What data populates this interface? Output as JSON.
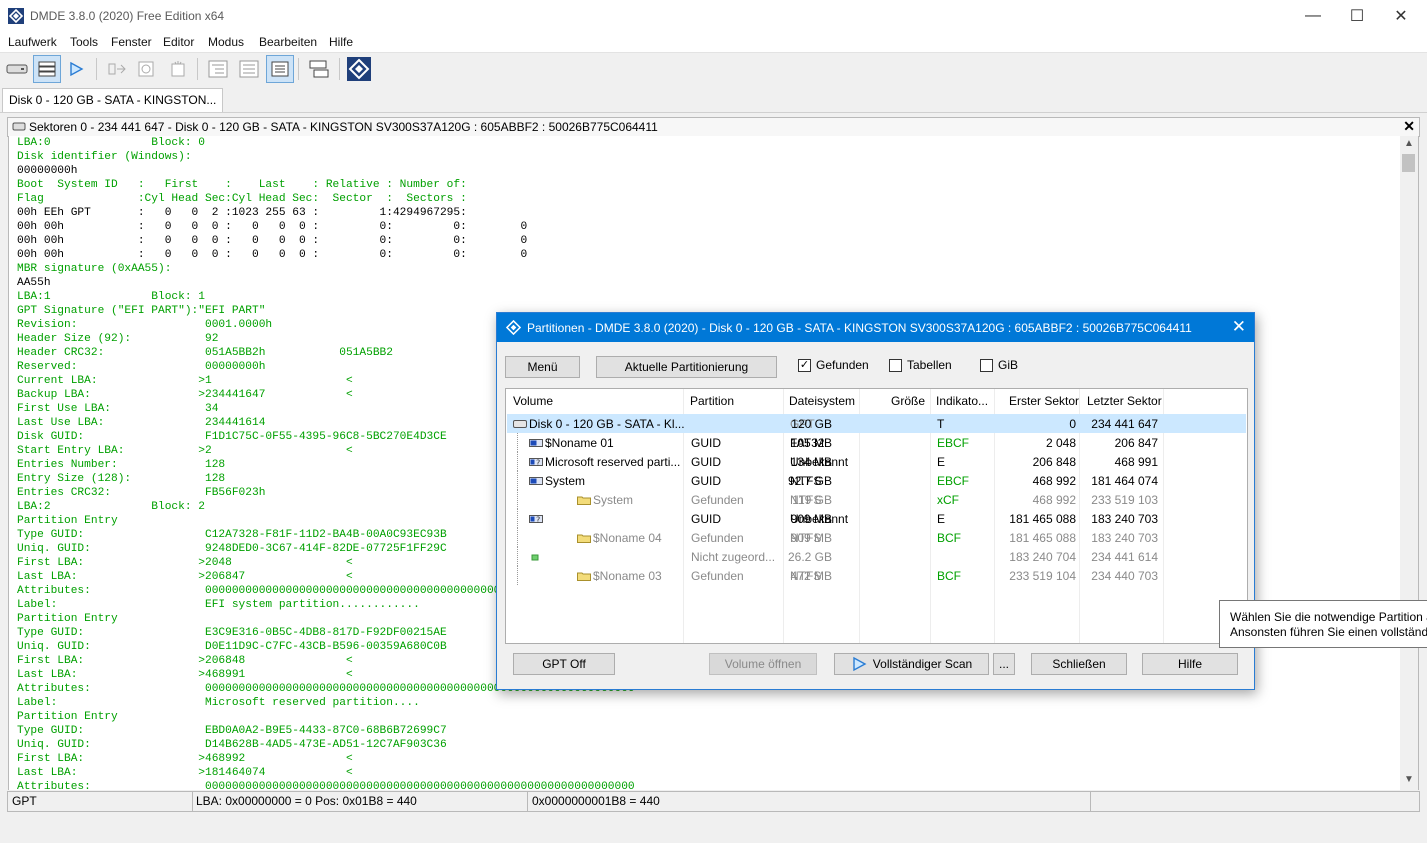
{
  "window": {
    "title": "DMDE 3.8.0 (2020) Free Edition x64"
  },
  "menu": [
    "Laufwerk",
    "Tools",
    "Fenster",
    "Editor",
    "Modus",
    "Bearbeiten",
    "Hilfe"
  ],
  "tab": {
    "label": "Disk 0 - 120 GB - SATA - KINGSTON..."
  },
  "sector_panel": {
    "title": "Sektoren 0 - 234 441 647 - Disk 0 - 120 GB - SATA - KINGSTON SV300S37A120G : 605ABBF2 : 50026B775C064411"
  },
  "hex_lines": [
    "LBA:0               Block: 0",
    "Disk identifier (Windows):",
    "00000000h",
    "Boot  System ID   :   First    :    Last    : Relative : Number of:",
    "Flag              :Cyl Head Sec:Cyl Head Sec:  Sector  :  Sectors :",
    "00h EEh GPT       :   0   0  2 :1023 255 63 :         1:4294967295:",
    "00h 00h           :   0   0  0 :   0   0  0 :         0:         0:        0",
    "00h 00h           :   0   0  0 :   0   0  0 :         0:         0:        0",
    "00h 00h           :   0   0  0 :   0   0  0 :         0:         0:        0",
    "MBR signature (0xAA55):",
    "AA55h",
    "LBA:1               Block: 1",
    "GPT Signature (\"EFI PART\"):\"EFI PART\"",
    "Revision:                   0001.0000h",
    "Header Size (92):           92",
    "Header CRC32:               051A5BB2h           051A5BB2",
    "Reserved:                   00000000h",
    "Current LBA:               >1                    <",
    "Backup LBA:                >234441647            <",
    "First Use LBA:              34",
    "Last Use LBA:               234441614",
    "Disk GUID:                  F1D1C75C-0F55-4395-96C8-5BC270E4D3CE",
    "Start Entry LBA:           >2                    <",
    "Entries Number:             128",
    "Entry Size (128):           128",
    "Entries CRC32:              FB56F023h",
    "LBA:2               Block: 2",
    "Partition Entry",
    "Type GUID:                  C12A7328-F81F-11D2-BA4B-00A0C93EC93B",
    "Uniq. GUID:                 9248DED0-3C67-414F-82DE-07725F1FF29C",
    "First LBA:                 >2048                 <",
    "Last LBA:                  >206847               <",
    "Attributes:                 0000000000000000000000000000000000000000000000000000000000000000",
    "Label:                      EFI system partition............",
    "Partition Entry",
    "Type GUID:                  E3C9E316-0B5C-4DB8-817D-F92DF00215AE",
    "Uniq. GUID:                 D0E11D9C-C7FC-43CB-B596-00359A680C0B",
    "First LBA:                 >206848               <",
    "Last LBA:                  >468991               <",
    "Attributes:                 0000000000000000000000000000000000000000000000000000000000000000",
    "Label:                      Microsoft reserved partition....",
    "Partition Entry",
    "Type GUID:                  EBD0A0A2-B9E5-4433-87C0-68B6B72699C7",
    "Uniq. GUID:                 D14B628B-4AD5-473E-AD51-12C7AF903C36",
    "First LBA:                 >468992               <",
    "Last LBA:                  >181464074            <",
    "Attributes:                 0000000000000000000000000000000000000000000000000000000000000000"
  ],
  "status": {
    "mode": "GPT",
    "lba": "LBA: 0x00000000 = 0  Pos: 0x01B8 = 440",
    "offset": "0x0000000001B8 = 440"
  },
  "dialog": {
    "title": "Partitionen - DMDE 3.8.0 (2020) - Disk 0 - 120 GB - SATA - KINGSTON SV300S37A120G : 605ABBF2 : 50026B775C064411",
    "menu_button": "Menü",
    "current_button": "Aktuelle Partitionierung",
    "checkbox_found": "Gefunden",
    "checkbox_tables": "Tabellen",
    "checkbox_gib": "GiB",
    "columns": [
      "Volume",
      "Partition",
      "Dateisystem",
      "Größe",
      "Indikato...",
      "Erster Sektor",
      "Letzter Sektor"
    ],
    "rows": [
      {
        "volume": "Disk 0 - 120 GB - SATA - Kl...",
        "partition": "",
        "fs": "GPT",
        "size": "120 GB",
        "ind": "T",
        "first": "0",
        "last": "234 441 647",
        "dim": false,
        "fsgray": true,
        "indgreen": false,
        "sel": true,
        "indent": 0,
        "icon": "disk-icon"
      },
      {
        "volume": "$Noname 01",
        "partition": "GUID",
        "fs": "FAT32",
        "size": "105 MB",
        "ind": "EBCF",
        "first": "2 048",
        "last": "206 847",
        "dim": false,
        "fsgray": false,
        "indgreen": true,
        "sel": false,
        "indent": 1,
        "icon": "partition-icon"
      },
      {
        "volume": "Microsoft reserved parti...",
        "partition": "GUID",
        "fs": "Unbekannt",
        "size": "134 MB",
        "ind": "E",
        "first": "206 848",
        "last": "468 991",
        "dim": false,
        "fsgray": false,
        "indgreen": false,
        "sel": false,
        "indent": 1,
        "icon": "unknown-partition-icon"
      },
      {
        "volume": "System",
        "partition": "GUID",
        "fs": "NTFS",
        "size": "92.7 GB",
        "ind": "EBCF",
        "first": "468 992",
        "last": "181 464 074",
        "dim": false,
        "fsgray": false,
        "indgreen": true,
        "sel": false,
        "indent": 1,
        "icon": "partition-icon"
      },
      {
        "volume": "System",
        "partition": "Gefunden",
        "fs": "NTFS",
        "size": "119 GB",
        "ind": "xCF",
        "first": "468 992",
        "last": "233 519 103",
        "dim": true,
        "fsgray": true,
        "indgreen": true,
        "sel": false,
        "indent": 2,
        "icon": "folder-icon"
      },
      {
        "volume": "",
        "partition": "GUID",
        "fs": "Unbekannt",
        "size": "909 MB",
        "ind": "E",
        "first": "181 465 088",
        "last": "183 240 703",
        "dim": false,
        "fsgray": false,
        "indgreen": false,
        "sel": false,
        "indent": 1,
        "icon": "unknown-partition-icon"
      },
      {
        "volume": "$Noname 04",
        "partition": "Gefunden",
        "fs": "NTFS",
        "size": "909 MB",
        "ind": "BCF",
        "first": "181 465 088",
        "last": "183 240 703",
        "dim": true,
        "fsgray": true,
        "indgreen": true,
        "sel": false,
        "indent": 2,
        "icon": "folder-icon"
      },
      {
        "volume": "",
        "partition": "Nicht zugeord...",
        "fs": "",
        "size": "26.2 GB",
        "ind": "",
        "first": "183 240 704",
        "last": "234 441 614",
        "dim": true,
        "fsgray": true,
        "indgreen": false,
        "sel": false,
        "indent": 1,
        "icon": "free-space-icon"
      },
      {
        "volume": "$Noname 03",
        "partition": "Gefunden",
        "fs": "NTFS",
        "size": "472 MB",
        "ind": "BCF",
        "first": "233 519 104",
        "last": "234 440 703",
        "dim": true,
        "fsgray": true,
        "indgreen": true,
        "sel": false,
        "indent": 2,
        "icon": "folder-icon"
      }
    ],
    "gpt_off": "GPT Off",
    "open_volume": "Volume öffnen",
    "full_scan": "Vollständiger Scan",
    "more": "...",
    "close": "Schließen",
    "help": "Hilfe"
  },
  "tooltip": {
    "line1": "Wählen Sie die notwendige Partition a",
    "line2": "Ansonsten führen Sie einen vollständi"
  },
  "colors": {
    "accent": "#0078d7",
    "green": "#00a000",
    "blue": "#1d4bb8",
    "selection": "#cce8ff"
  }
}
